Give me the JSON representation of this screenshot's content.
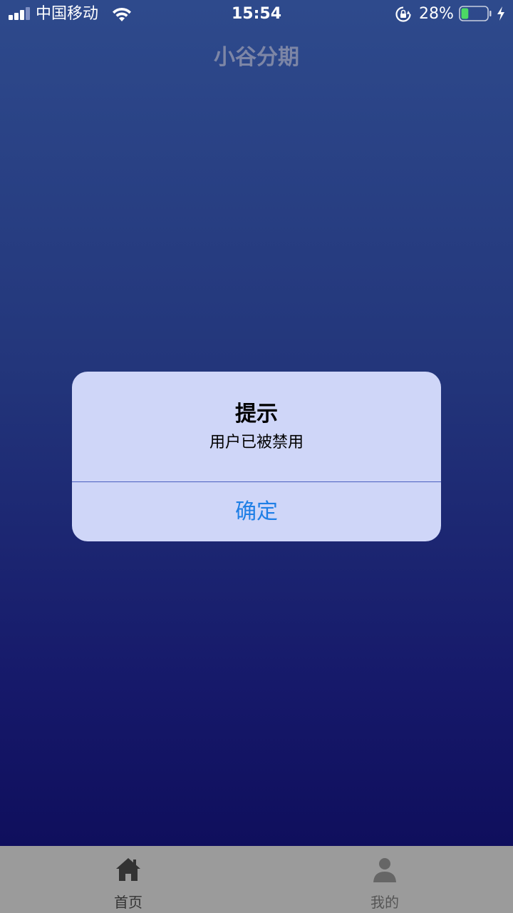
{
  "status_bar": {
    "carrier": "中国移动",
    "time": "15:54",
    "battery_percent": "28%",
    "battery_level": 0.28,
    "battery_color": "#4cd964"
  },
  "header": {
    "title": "小谷分期"
  },
  "dialog": {
    "title": "提示",
    "message": "用户已被禁用",
    "confirm_label": "确定",
    "confirm_color": "#1e7fe6"
  },
  "tab_bar": {
    "items": [
      {
        "label": "首页",
        "icon": "home-icon",
        "active": true
      },
      {
        "label": "我的",
        "icon": "person-icon",
        "active": false
      }
    ]
  }
}
